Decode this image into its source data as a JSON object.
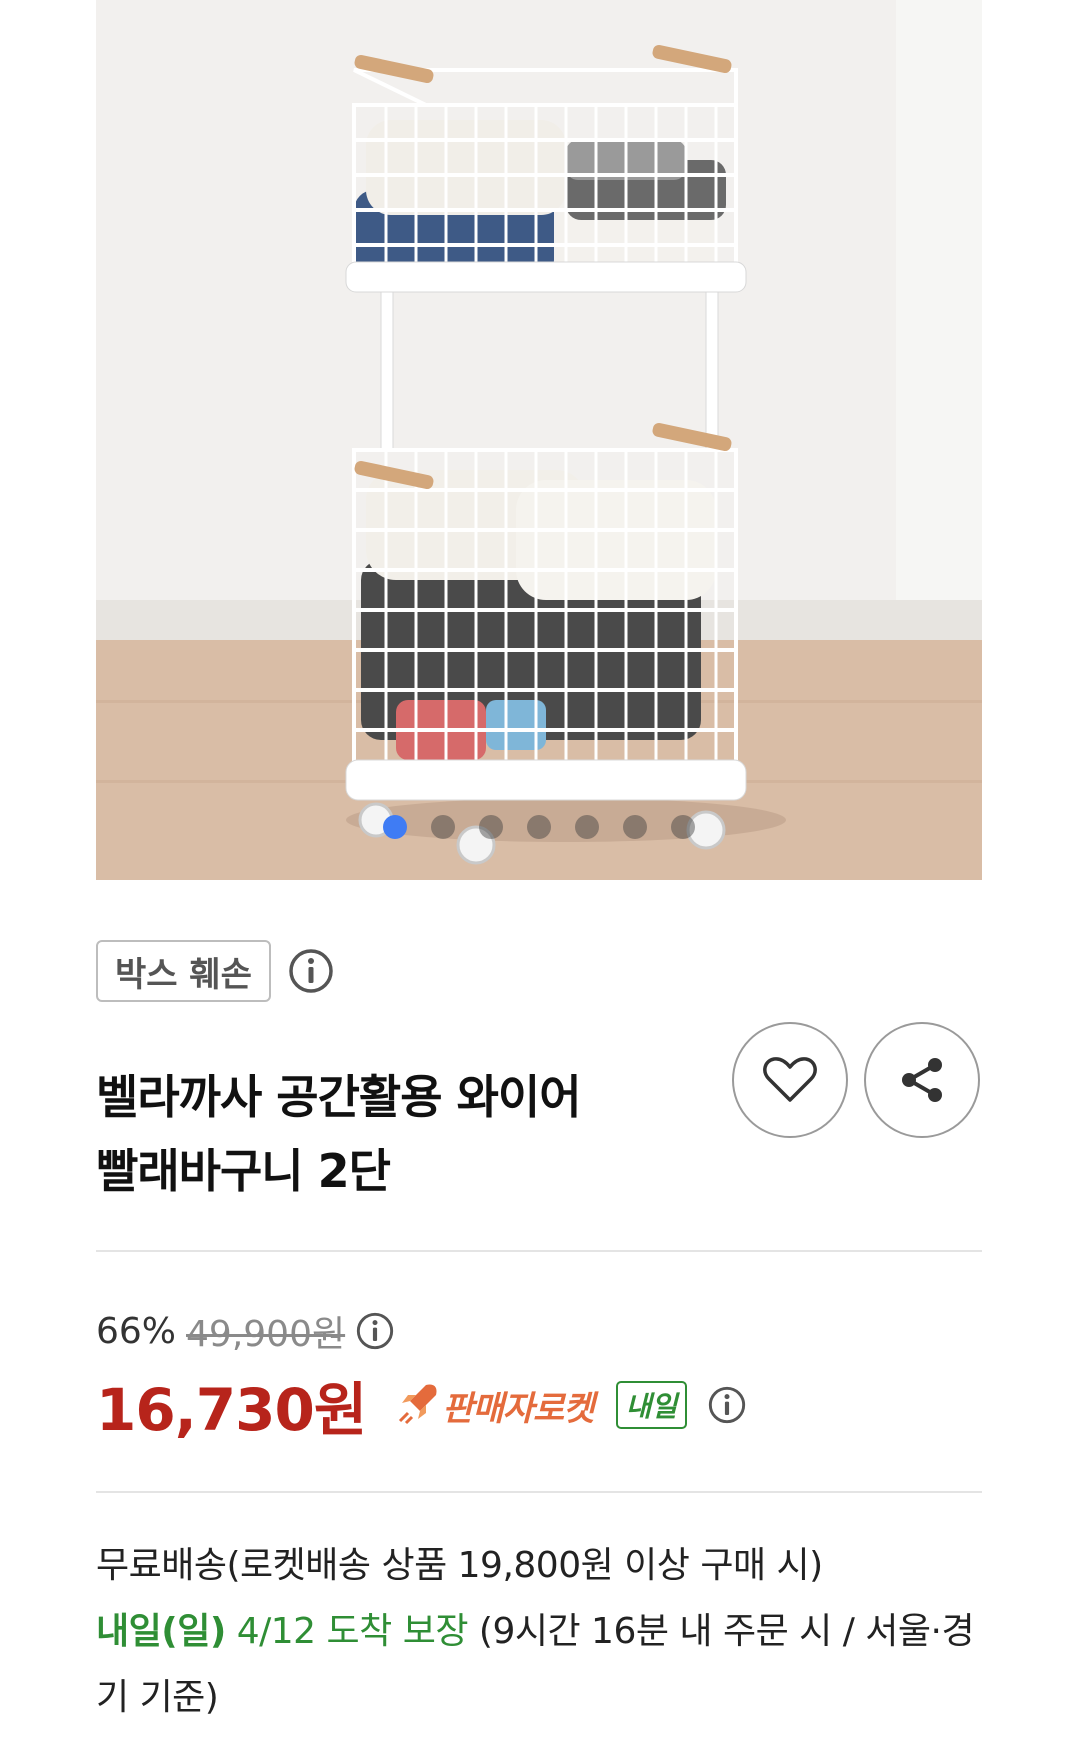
{
  "product": {
    "image": {
      "alt": "",
      "slides_total": 7,
      "slide_current": 1
    },
    "badge": "박스 훼손",
    "title_line1": "벨라까사 공간활용 와이어",
    "title_line2": "빨래바구니 2단",
    "favorite_icon": "heart-icon",
    "share_icon": "share-icon"
  },
  "price": {
    "discount": "66%",
    "original": "49,900원",
    "sale": "16,730원",
    "seller_rocket": "판매자로켓",
    "tomorrow_badge": "내일"
  },
  "delivery": {
    "line1": "무료배송(로켓배송 상품 19,800원 이상 구매 시)",
    "arrival_day": "내일(일)",
    "arrival_date": "4/12 도착 보장",
    "condition": "(9시간 16분 내 주문 시 / 서울·경기 기준)"
  },
  "colors": {
    "sale_price": "#b7241b",
    "rocket": "#e46b3c",
    "green": "#2f8e35",
    "active_dot": "#3f7cf4"
  }
}
